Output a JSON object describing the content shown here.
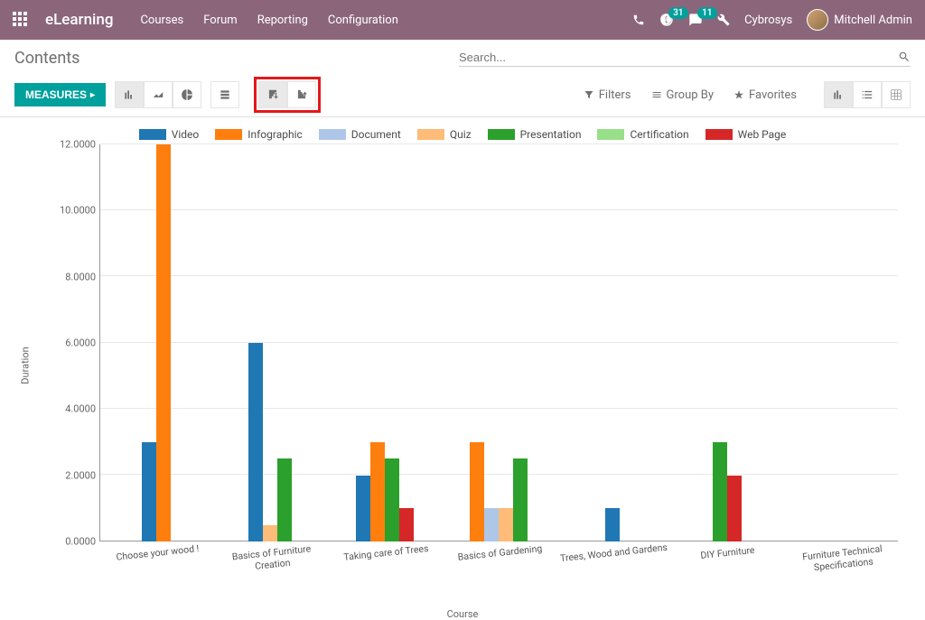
{
  "topnav": {
    "brand": "eLearning",
    "menu": [
      "Courses",
      "Forum",
      "Reporting",
      "Configuration"
    ],
    "badge_activities": "31",
    "badge_messages": "11",
    "company": "Cybrosys",
    "user": "Mitchell Admin"
  },
  "breadcrumb": "Contents",
  "search": {
    "placeholder": "Search..."
  },
  "buttons": {
    "measures": "MEASURES"
  },
  "search_options": {
    "filters": "Filters",
    "groupby": "Group By",
    "favorites": "Favorites"
  },
  "chart_data": {
    "type": "bar",
    "title": "",
    "xlabel": "Course",
    "ylabel": "Duration",
    "ylim": [
      0,
      12
    ],
    "yticks": [
      0,
      2,
      4,
      6,
      8,
      10,
      12
    ],
    "categories": [
      "Choose your wood !",
      "Basics of Furniture Creation",
      "Taking care of Trees",
      "Basics of Gardening",
      "Trees, Wood and Gardens",
      "DIY Furniture",
      "Furniture Technical Specifications"
    ],
    "series": [
      {
        "name": "Video",
        "color": "#1f77b4",
        "values": [
          3,
          6,
          2,
          null,
          1,
          null,
          null
        ]
      },
      {
        "name": "Infographic",
        "color": "#ff7f0e",
        "values": [
          12,
          null,
          3,
          3,
          null,
          null,
          null
        ]
      },
      {
        "name": "Document",
        "color": "#aec7e8",
        "values": [
          null,
          null,
          null,
          1,
          null,
          null,
          null
        ]
      },
      {
        "name": "Quiz",
        "color": "#ffbb78",
        "values": [
          null,
          0.5,
          null,
          1,
          null,
          null,
          null
        ]
      },
      {
        "name": "Presentation",
        "color": "#2ca02c",
        "values": [
          null,
          2.5,
          2.5,
          2.5,
          null,
          3,
          null
        ]
      },
      {
        "name": "Certification",
        "color": "#98df8a",
        "values": [
          null,
          null,
          null,
          null,
          null,
          null,
          null
        ]
      },
      {
        "name": "Web Page",
        "color": "#d62728",
        "values": [
          null,
          null,
          1,
          null,
          null,
          2,
          null
        ]
      }
    ]
  }
}
